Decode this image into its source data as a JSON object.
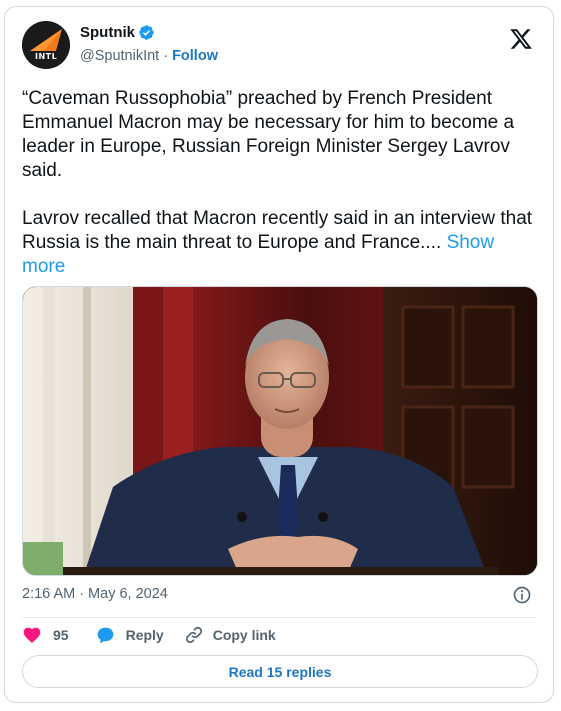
{
  "author": {
    "name": "Sputnik",
    "handle": "@SputnikInt",
    "follow_label": "Follow",
    "avatar_text": "INTL",
    "verified": true
  },
  "tweet": {
    "paragraph1": "“Caveman Russophobia” preached by French President Emmanuel Macron may be necessary for him to become a leader in Europe, Russian Foreign Minister Sergey Lavrov said.",
    "paragraph2": "Lavrov recalled that Macron recently said in an interview that Russia is the main threat to Europe and France....",
    "show_more_label": "Show more"
  },
  "meta": {
    "time": "2:16 AM",
    "date": "May 6, 2024",
    "separator": "·"
  },
  "actions": {
    "like_count": "95",
    "reply_label": "Reply",
    "copy_link_label": "Copy link"
  },
  "read_replies_label": "Read 15 replies",
  "colors": {
    "accent": "#1d9bf0",
    "like": "#f91880",
    "text": "#0f1419",
    "muted": "#536471",
    "border": "#cfd9de"
  },
  "icons": [
    "x-logo-icon",
    "verified-badge-icon",
    "heart-icon",
    "reply-bubble-icon",
    "link-icon",
    "info-icon"
  ]
}
